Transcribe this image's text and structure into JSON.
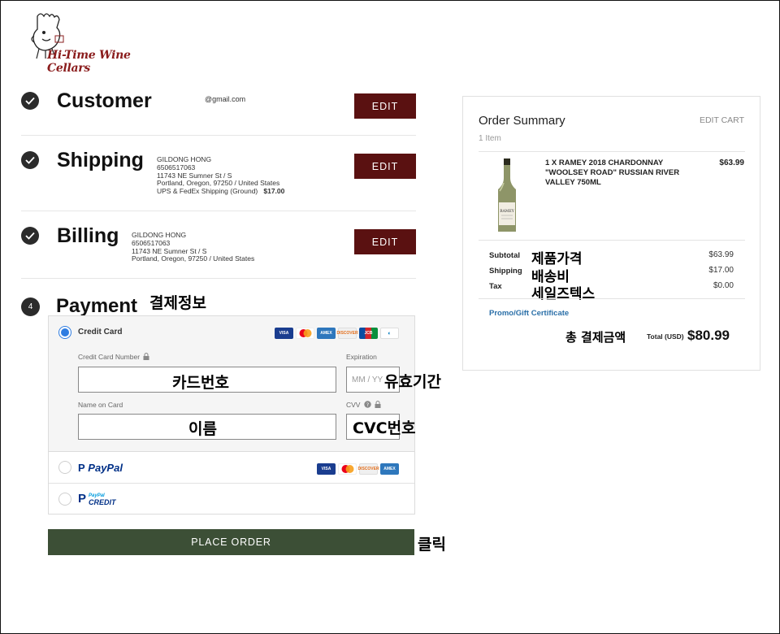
{
  "store": {
    "name": "Hi-Time Wine Cellars"
  },
  "steps": {
    "customer": {
      "title": "Customer",
      "email": "@gmail.com",
      "edit_label": "EDIT"
    },
    "shipping": {
      "title": "Shipping",
      "name": "GILDONG HONG",
      "phone": "6506517063",
      "street": "11743 NE Sumner St / S",
      "city": "Portland, Oregon, 97250 / United States",
      "method": "UPS & FedEx Shipping (Ground)",
      "method_price": "$17.00",
      "edit_label": "EDIT"
    },
    "billing": {
      "title": "Billing",
      "name": "GILDONG HONG",
      "phone": "6506517063",
      "street": "11743 NE Sumner St / S",
      "city": "Portland, Oregon, 97250 / United States",
      "edit_label": "EDIT"
    },
    "payment": {
      "number": "4",
      "title": "Payment"
    }
  },
  "payment": {
    "credit_card_label": "Credit Card",
    "card_number_label": "Credit Card Number",
    "expiration_label": "Expiration",
    "expiration_placeholder": "MM / YY",
    "name_label": "Name on Card",
    "cvv_label": "CVV",
    "paypal_label": "PayPal",
    "paypal_credit_top": "PayPal",
    "paypal_credit_bottom": "CREDIT",
    "place_order_label": "PLACE ORDER",
    "card_brands": [
      "VISA",
      "Mastercard",
      "AMEX",
      "DISCOVER",
      "JCB",
      "Diners"
    ]
  },
  "annotations": {
    "payment_info": "결제정보",
    "card_number": "카드번호",
    "expiry": "유효기간",
    "name": "이름",
    "cvc": "CVC번호",
    "click": "클릭",
    "product_price": "제품가격",
    "shipping_fee": "배송비",
    "sales_tax": "세일즈텍스",
    "total_amount": "총 결제금액"
  },
  "summary": {
    "title": "Order Summary",
    "edit_cart": "EDIT CART",
    "item_count": "1 Item",
    "item_name": "1 X RAMEY 2018 CHARDONNAY \"WOOLSEY ROAD\" RUSSIAN RIVER VALLEY 750ML",
    "item_price": "$63.99",
    "bottle_label": "RAMEY",
    "subtotal_label": "Subtotal",
    "subtotal": "$63.99",
    "shipping_label": "Shipping",
    "shipping": "$17.00",
    "tax_label": "Tax",
    "tax": "$0.00",
    "promo_label": "Promo/Gift Certificate",
    "total_label": "Total (USD)",
    "total": "$80.99"
  },
  "colors": {
    "edit_button": "#5a1111",
    "place_order": "#3c4f36",
    "radio_selected": "#2f7de1",
    "promo_link": "#2a6fa8"
  }
}
